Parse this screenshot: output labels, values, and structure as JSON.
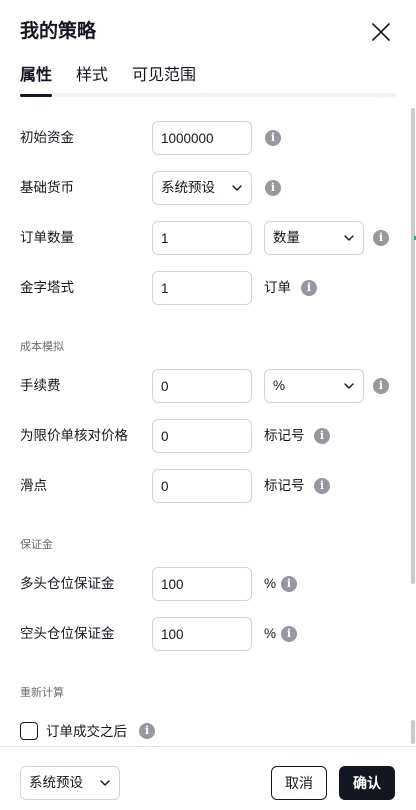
{
  "dialog": {
    "title": "我的策略",
    "close_icon": "close-icon"
  },
  "tabs": [
    {
      "label": "属性",
      "active": true
    },
    {
      "label": "样式",
      "active": false
    },
    {
      "label": "可见范围",
      "active": false
    }
  ],
  "fields": {
    "initial_capital": {
      "label": "初始资金",
      "value": "1000000"
    },
    "base_currency": {
      "label": "基础货币",
      "value": "系统预设"
    },
    "order_size": {
      "label": "订单数量",
      "value": "1",
      "unit_select": "数量"
    },
    "pyramiding": {
      "label": "金字塔式",
      "value": "1",
      "unit": "订单"
    }
  },
  "sections": {
    "cost_simulation": "成本模拟",
    "margin": "保证金",
    "recalculate": "重新计算"
  },
  "cost_fields": {
    "commission": {
      "label": "手续费",
      "value": "0",
      "unit_select": "%"
    },
    "verify_price_limit": {
      "label": "为限价单核对价格",
      "value": "0",
      "unit": "标记号"
    },
    "slippage": {
      "label": "滑点",
      "value": "0",
      "unit": "标记号"
    }
  },
  "margin_fields": {
    "long_margin": {
      "label": "多头仓位保证金",
      "value": "100",
      "unit": "%"
    },
    "short_margin": {
      "label": "空头仓位保证金",
      "value": "100",
      "unit": "%"
    }
  },
  "recalculate": {
    "after_order_filled": {
      "label": "订单成交之后",
      "checked": false
    }
  },
  "footer": {
    "preset": "系统预设",
    "cancel": "取消",
    "ok": "确认"
  },
  "info_icon_glyph": "i",
  "colors": {
    "primary_text": "#131722",
    "muted_text": "#6a6d78",
    "border": "#d1d4dc",
    "info_icon": "#9598a1",
    "primary_button": "#131722"
  }
}
